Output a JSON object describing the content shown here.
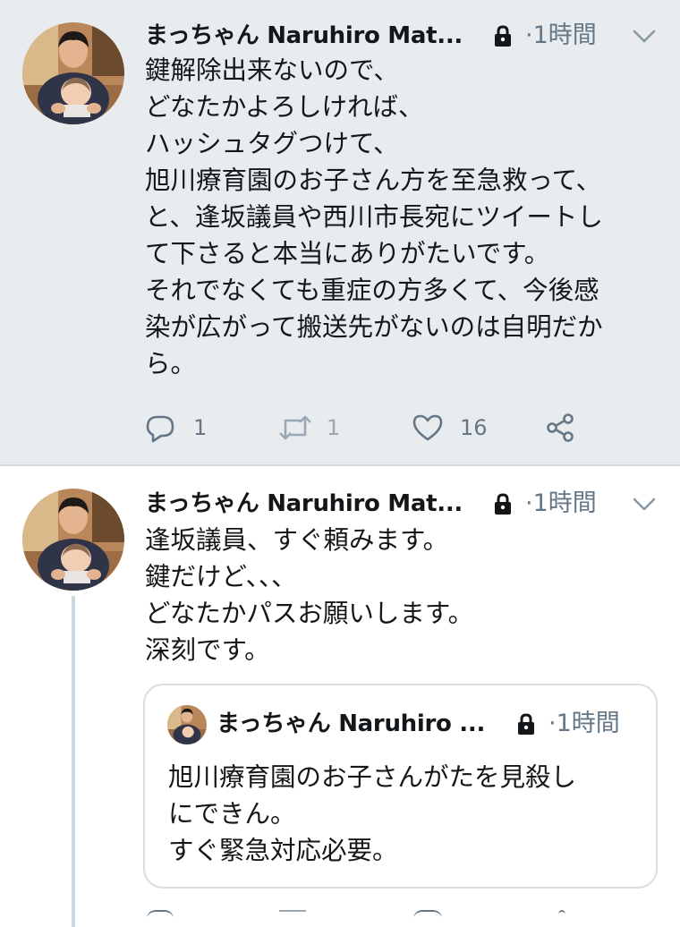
{
  "tweets": [
    {
      "display_name": "まっちゃん Naruhiro Mat...",
      "protected_icon": "lock-icon",
      "timestamp": "·1時間",
      "menu_icon": "chevron-down-icon",
      "text": "鍵解除出来ないので、\nどなたかよろしければ、\nハッシュタグつけて、\n旭川療育園のお子さん方を至急救って、\nと、逢坂議員や西川市長宛にツイートし\nて下さると本当にありがたいです。\nそれでなくても重症の方多くて、今後感\n染が広がって搬送先がないのは自明だか\nら。",
      "actions": {
        "reply_icon": "reply-icon",
        "reply_count": "1",
        "retweet_icon": "retweet-icon",
        "retweet_count": "1",
        "like_icon": "heart-icon",
        "like_count": "16",
        "share_icon": "share-icon"
      }
    },
    {
      "display_name": "まっちゃん Naruhiro Mat...",
      "protected_icon": "lock-icon",
      "timestamp": "·1時間",
      "menu_icon": "chevron-down-icon",
      "text": "逢坂議員、すぐ頼みます。\n鍵だけど、、、\nどなたかパスお願いします。\n深刻です。",
      "quoted": {
        "display_name": "まっちゃん Naruhiro ...",
        "protected_icon": "lock-icon",
        "timestamp": "·1時間",
        "text": "旭川療育園のお子さんがたを見殺し\nにできん。\nすぐ緊急対応必要。"
      }
    }
  ],
  "colors": {
    "highlighted_tweet_bg": "#e8ecef",
    "text": "#14171a",
    "secondary_text": "#657786",
    "thread_line": "#ccd6dd",
    "icon": "#657786"
  }
}
